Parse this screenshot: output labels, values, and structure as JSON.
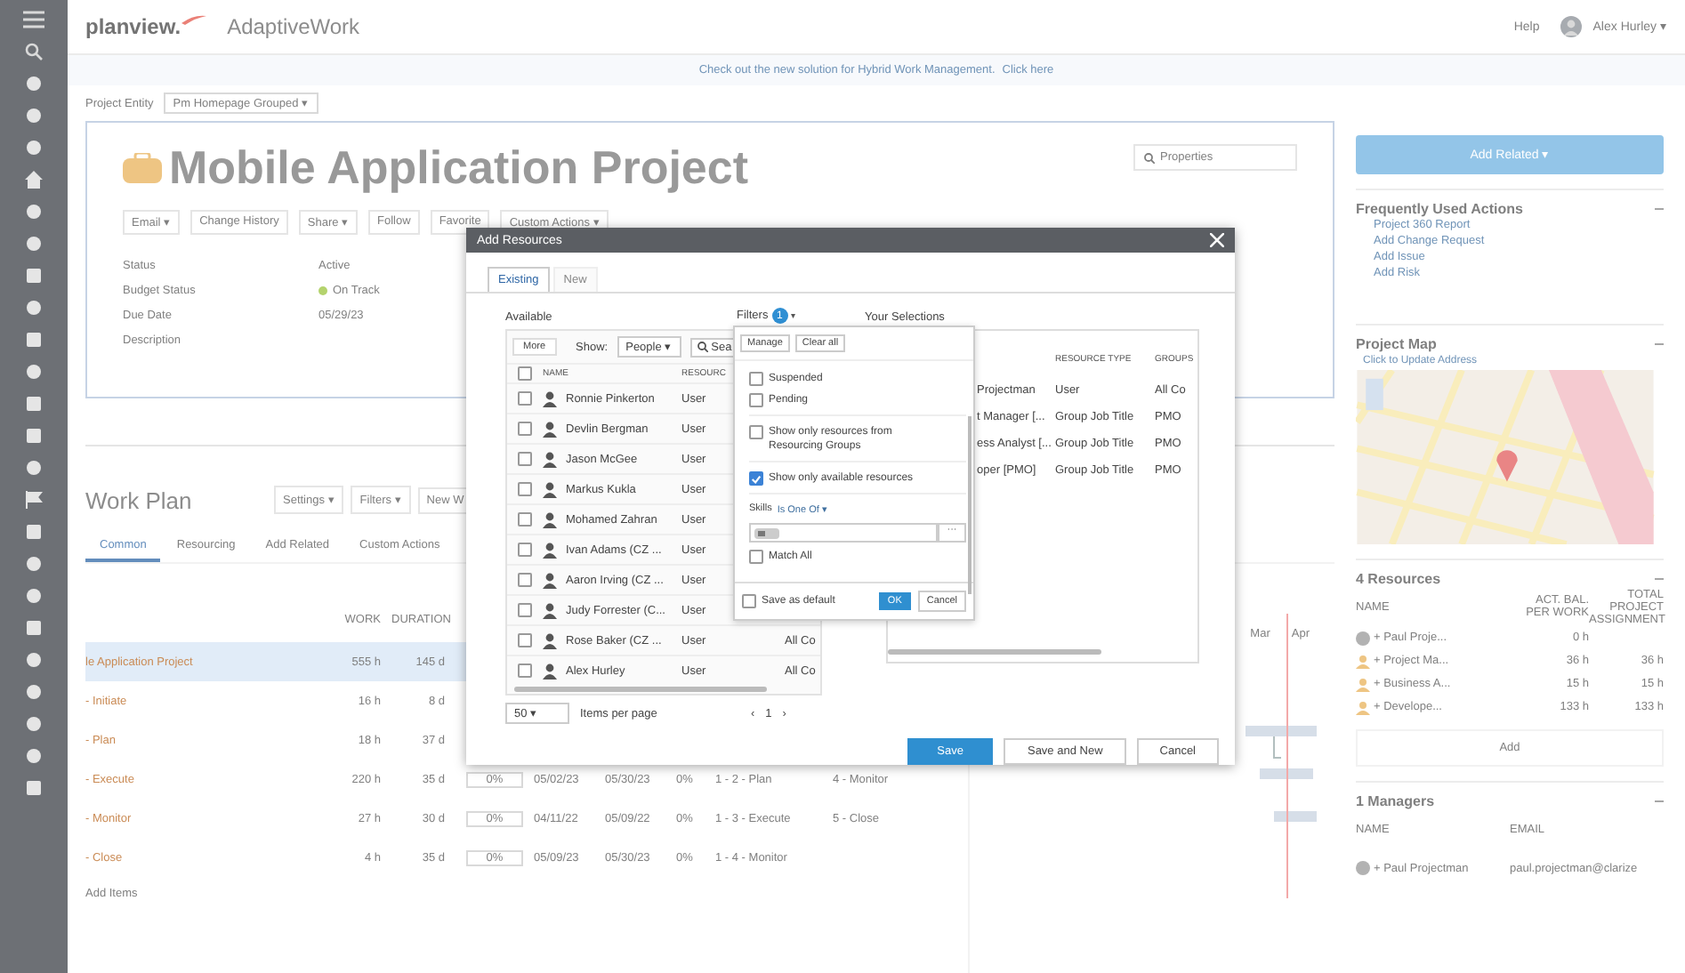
{
  "app": {
    "logo": "planview.",
    "product": "AdaptiveWork",
    "help": "Help",
    "user": "Alex Hurley ▾"
  },
  "banner": {
    "text": "Check out the new solution for Hybrid Work Management.",
    "link": "Click here"
  },
  "entity": {
    "label": "Project Entity",
    "value": "Pm Homepage Grouped ▾"
  },
  "project": {
    "title": "Mobile Application Project",
    "search_placeholder": "Properties",
    "toolbar": [
      "Email ▾",
      "Change History",
      "Share ▾",
      "Follow",
      "Favorite",
      "Custom Actions ▾"
    ],
    "fields": [
      {
        "label": "Status",
        "value": "Active"
      },
      {
        "label": "Budget Status",
        "value": "On Track"
      },
      {
        "label": "Due Date",
        "value": "05/29/23"
      },
      {
        "label": "Description"
      }
    ]
  },
  "work_plan": {
    "title": "Work Plan",
    "buttons": [
      "Settings ▾",
      "Filters ▾",
      "New W"
    ],
    "tabs": [
      {
        "label": "Common",
        "selected": true
      },
      {
        "label": "Resourcing",
        "selected": false
      },
      {
        "label": "Add Related",
        "selected": false
      },
      {
        "label": "Custom Actions",
        "selected": false
      }
    ],
    "columns": [
      "WORK",
      "DURATION"
    ],
    "rows": [
      {
        "name": "le Application Project",
        "work": "555 h",
        "duration": "145 d",
        "selected": true
      },
      {
        "name": "- Initiate",
        "work": "16 h",
        "duration": "8 d",
        "selected": false
      },
      {
        "name": "- Plan",
        "work": "18 h",
        "duration": "37 d",
        "selected": false
      },
      {
        "name": "- Execute",
        "work": "220 h",
        "duration": "35 d",
        "selected": false,
        "progress": "0%",
        "start": "05/02/23",
        "finish": "05/30/23",
        "complete": "0%",
        "predecessor": "1 - 2 - Plan",
        "successor": "4 - Monitor"
      },
      {
        "name": "- Monitor",
        "work": "27 h",
        "duration": "30 d",
        "selected": false,
        "progress": "0%",
        "start": "04/11/22",
        "finish": "05/09/22",
        "complete": "0%",
        "predecessor": "1 - 3 - Execute",
        "successor": "5 - Close"
      },
      {
        "name": "- Close",
        "work": "4 h",
        "duration": "35 d",
        "selected": false,
        "progress": "0%",
        "start": "05/09/23",
        "finish": "05/30/23",
        "complete": "0%",
        "predecessor": "1 - 4 - Monitor"
      }
    ],
    "add": "Add Items",
    "months": [
      "Mar",
      "Apr"
    ]
  },
  "sidebar": {
    "add_related": "Add Related ▾",
    "actions": {
      "title": "Frequently Used Actions",
      "items": [
        "Project 360 Report",
        "Add Change Request",
        "Add Issue",
        "Add Risk"
      ]
    },
    "map": {
      "title": "Project Map",
      "link": "Click to Update Address"
    },
    "resources": {
      "title": "4 Resources",
      "columns": [
        "NAME",
        "ACT. BAL. PER WORK",
        "TOTAL PROJECT ASSIGNMENT"
      ],
      "rows": [
        {
          "name": "+ Paul Proje...",
          "work": "0 h"
        },
        {
          "name": "+ Project Ma...",
          "work": "36 h",
          "total": "36 h"
        },
        {
          "name": "+ Business A...",
          "work": "15 h",
          "total": "15 h"
        },
        {
          "name": "+ Develope...",
          "work": "133 h",
          "total": "133 h"
        }
      ],
      "add": "Add"
    },
    "managers": {
      "title": "1 Managers",
      "columns": [
        "NAME",
        "EMAIL"
      ],
      "rows": [
        {
          "name": "+ Paul Projectman",
          "email": "paul.projectman@clarize"
        }
      ]
    }
  },
  "dialog": {
    "title": "Add Resources",
    "tabs": [
      {
        "label": "Existing",
        "selected": true
      },
      {
        "label": "New",
        "selected": false
      }
    ],
    "available": {
      "title": "Available",
      "more": "More",
      "show_label": "Show:",
      "show_value": "People ▾",
      "search": "Sea",
      "columns": [
        "NAME",
        "RESOURC"
      ],
      "all_checked": false,
      "rows": [
        {
          "name": "Ronnie Pinkerton",
          "type": "User",
          "checked": false
        },
        {
          "name": "Devlin Bergman",
          "type": "User",
          "checked": false
        },
        {
          "name": "Jason McGee",
          "type": "User",
          "checked": false
        },
        {
          "name": "Markus Kukla",
          "type": "User",
          "checked": false
        },
        {
          "name": "Mohamed Zahran",
          "type": "User",
          "checked": false
        },
        {
          "name": "Ivan Adams (CZ ...",
          "type": "User",
          "checked": false
        },
        {
          "name": "Aaron Irving (CZ ...",
          "type": "User",
          "checked": false
        },
        {
          "name": "Judy Forrester (C...",
          "type": "User",
          "checked": false
        },
        {
          "name": "Rose Baker (CZ ...",
          "type": "User",
          "group": "All Co",
          "checked": false
        },
        {
          "name": "Alex Hurley",
          "type": "User",
          "group": "All Co",
          "checked": false
        }
      ],
      "page_size": "50 ▾",
      "per_page": "Items per page",
      "prev": "‹",
      "page": "1",
      "next": "›"
    },
    "filters": {
      "label": "Filters",
      "count": "1",
      "caret": "▾",
      "manage": "Manage",
      "clear": "Clear all",
      "options": [
        {
          "label": "Suspended",
          "checked": false
        },
        {
          "label": "Pending",
          "checked": false
        },
        {
          "label": "Show only resources from Resourcing Groups",
          "checked": false
        },
        {
          "label": "Show only available resources",
          "checked": true
        }
      ],
      "skills_label": "Skills",
      "skills_op": "Is One Of ▾",
      "more": "···",
      "match_all": {
        "label": "Match All",
        "checked": false
      },
      "save_default": {
        "label": "Save as default",
        "checked": false
      },
      "ok": "OK",
      "cancel": "Cancel"
    },
    "selections": {
      "title": "Your Selections",
      "columns": [
        "RESOURCE TYPE",
        "GROUPS"
      ],
      "rows": [
        {
          "name": "Projectman",
          "type": "User",
          "group": "All Co"
        },
        {
          "name": "t Manager [...",
          "type": "Group Job Title",
          "group": "PMO"
        },
        {
          "name": "ess Analyst [...",
          "type": "Group Job Title",
          "group": "PMO"
        },
        {
          "name": "oper [PMO]",
          "type": "Group Job Title",
          "group": "PMO"
        }
      ]
    },
    "buttons": [
      {
        "label": "Save",
        "kind": "primary"
      },
      {
        "label": "Save and New",
        "kind": "secondary"
      },
      {
        "label": "Cancel",
        "kind": "secondary"
      }
    ]
  }
}
